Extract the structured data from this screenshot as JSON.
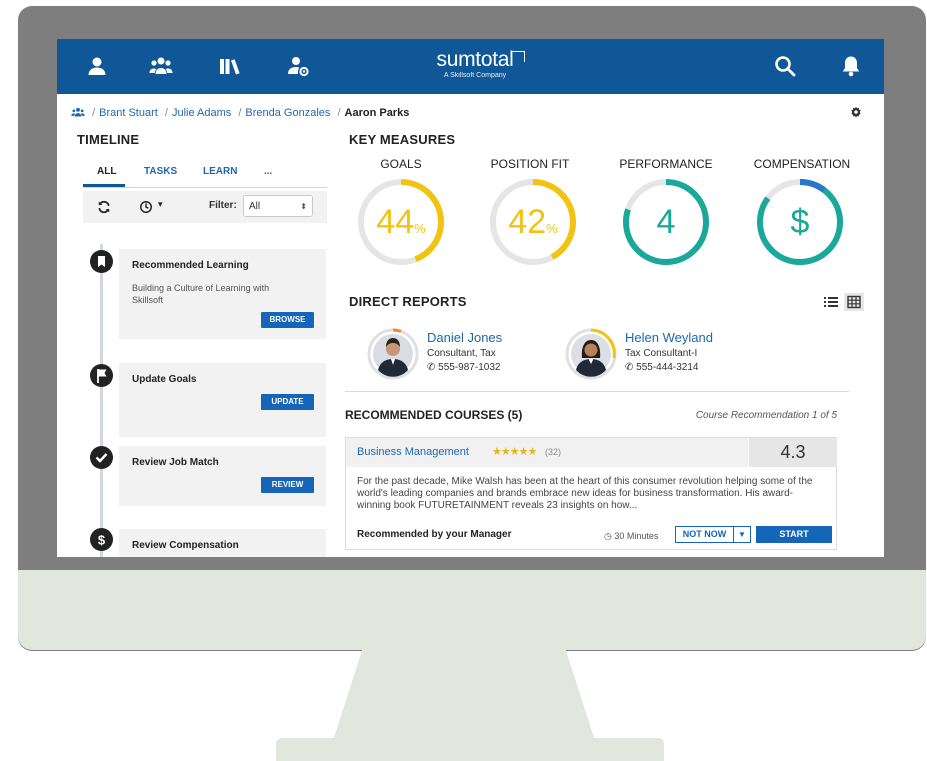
{
  "app": {
    "logo": "sumtotal",
    "logo_sub": "A Skillsoft Company"
  },
  "nav_icons": [
    "user-icon",
    "team-icon",
    "library-icon",
    "user-settings-icon",
    "search-icon",
    "bell-icon"
  ],
  "breadcrumb": {
    "items": [
      "Brant Stuart",
      "Julie Adams",
      "Brenda Gonzales"
    ],
    "current": "Aaron Parks"
  },
  "timeline": {
    "title": "TIMELINE",
    "tabs": [
      "ALL",
      "TASKS",
      "LEARN",
      "..."
    ],
    "filter_label": "Filter:",
    "filter_value": "All",
    "items": [
      {
        "title": "Recommended Learning",
        "desc": "Building a Culture of Learning with Skillsoft",
        "button": "BROWSE",
        "icon": "bookmark-icon"
      },
      {
        "title": "Update Goals",
        "button": "UPDATE",
        "icon": "flag-icon"
      },
      {
        "title": "Review Job Match",
        "button": "REVIEW",
        "icon": "check-icon"
      },
      {
        "title": "Review Compensation",
        "icon": "dollar-icon"
      }
    ]
  },
  "key_measures": {
    "title": "KEY MEASURES",
    "gauges": [
      {
        "label": "GOALS",
        "value": "44",
        "unit": "%",
        "fraction": 0.44,
        "color": "#f2c313"
      },
      {
        "label": "POSITION FIT",
        "value": "42",
        "unit": "%",
        "fraction": 0.42,
        "color": "#f2c313"
      },
      {
        "label": "PERFORMANCE",
        "value": "4",
        "unit": "",
        "fraction": 0.8,
        "color": "#1aa89a"
      },
      {
        "label": "COMPENSATION",
        "value": "$",
        "unit": "",
        "fraction": 0.85,
        "color": "#1aa89a"
      }
    ]
  },
  "direct_reports": {
    "title": "DIRECT REPORTS",
    "people": [
      {
        "name": "Daniel Jones",
        "role": "Consultant, Tax",
        "phone": "555-987-1032"
      },
      {
        "name": "Helen Weyland",
        "role": "Tax Consultant-I",
        "phone": "555-444-3214"
      }
    ]
  },
  "recommended_courses": {
    "title": "RECOMMENDED COURSES (5)",
    "pager": "Course Recommendation 1 of 5",
    "course": {
      "title": "Business Management",
      "stars": "★★★★★",
      "count": "(32)",
      "score": "4.3",
      "desc": "For the past decade, Mike Walsh has been at the heart of this consumer revolution helping some of the world's leading companies and brands embrace new ideas for business transformation. His award-winning book FUTURETAINMENT reveals 23 insights on how...",
      "recommended_by": "Recommended by your Manager",
      "duration": "30 Minutes",
      "not_now": "NOT NOW",
      "start": "START"
    }
  },
  "colors": {
    "brand": "#0f5796",
    "accent": "#1565b8",
    "yellow": "#f2c313",
    "teal": "#1aa89a"
  }
}
